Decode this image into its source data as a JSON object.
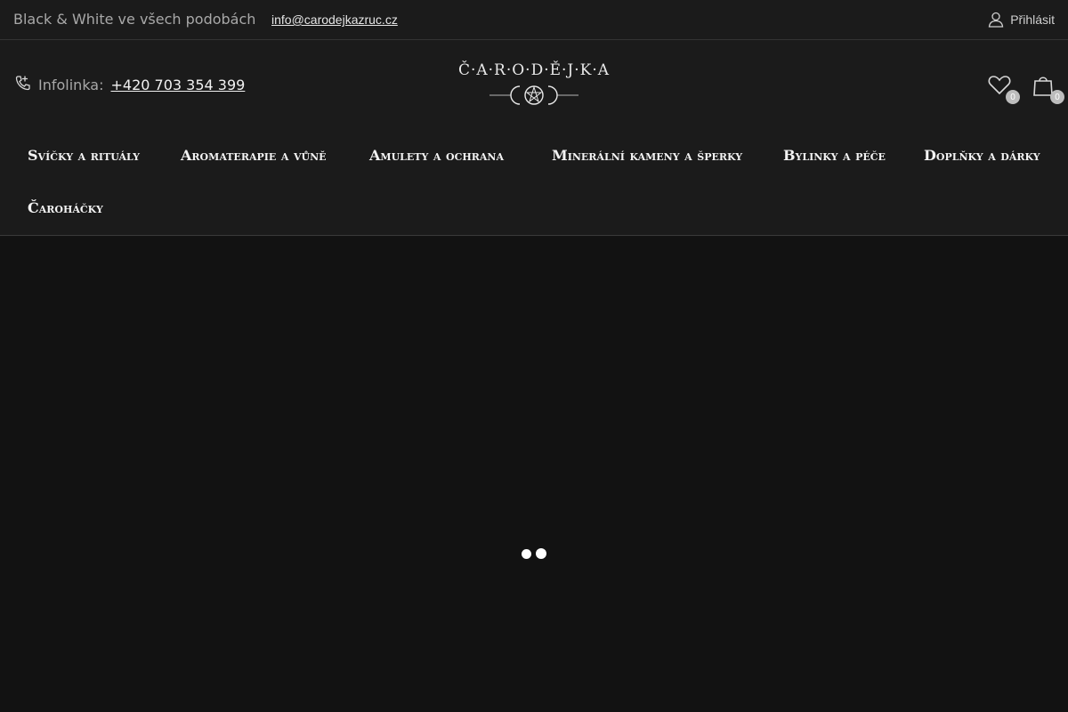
{
  "topbar": {
    "tagline": "Black & White ve všech podobách",
    "email": "info@carodejkazruc.cz",
    "login_label": "Přihlásit"
  },
  "header": {
    "infoline_label": "Infolinka:",
    "infoline_phone": "+420 703 354 399",
    "logo_text": "Č·A·R·O·D·Ě·J·K·A",
    "wishlist_count": "0",
    "cart_count": "0"
  },
  "nav": {
    "items": [
      {
        "label": "Svíčky a rituály"
      },
      {
        "label": "Aromaterapie a vůně"
      },
      {
        "label": "Amulety a ochrana"
      },
      {
        "label": "Minerální kameny a šperky"
      },
      {
        "label": "Bylinky a péče"
      },
      {
        "label": "Doplňky a dárky"
      },
      {
        "label": "Čaroháčky"
      }
    ]
  },
  "colors": {
    "background": "#141414",
    "header": "#1b1b1b",
    "text": "#ffffff",
    "muted": "#a8a8a8",
    "badge": "#bdbdbd"
  },
  "icons": [
    "user-icon",
    "phone-icon",
    "heart-icon",
    "shopping-bag-icon",
    "loader-icon"
  ]
}
